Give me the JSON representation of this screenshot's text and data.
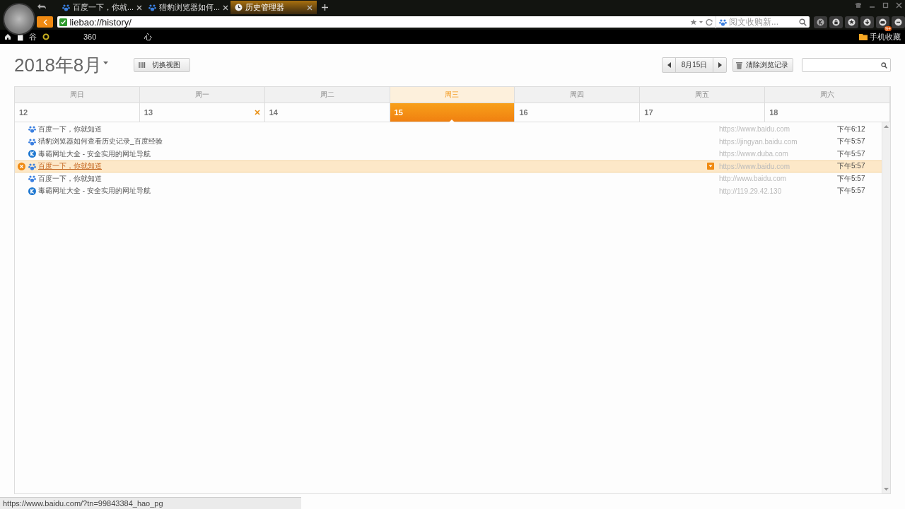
{
  "browser": {
    "tabs": [
      {
        "title": "百度一下，你就...",
        "kind": "paw",
        "selected": false
      },
      {
        "title": "猎豹浏览器如何...",
        "kind": "paw",
        "selected": false
      },
      {
        "title": "历史管理器",
        "kind": "clock",
        "selected": true
      }
    ],
    "address": "liebao://history/",
    "search_placeholder": "阅文收购新...",
    "bookmarks": [
      "谷",
      "360",
      "心"
    ],
    "mobile_bookmarks": "手机收藏",
    "badge": "9+"
  },
  "page": {
    "month": "2018年8月",
    "switch_view": "切换视图",
    "date": "8月15日",
    "clear": "清除浏览记录",
    "days": [
      {
        "weekday": "周日",
        "date": "12",
        "selected": false,
        "deletable": false
      },
      {
        "weekday": "周一",
        "date": "13",
        "selected": false,
        "deletable": true
      },
      {
        "weekday": "周二",
        "date": "14",
        "selected": false,
        "deletable": false
      },
      {
        "weekday": "周三",
        "date": "15",
        "selected": true,
        "deletable": false
      },
      {
        "weekday": "周四",
        "date": "16",
        "selected": false,
        "deletable": false
      },
      {
        "weekday": "周五",
        "date": "17",
        "selected": false,
        "deletable": false
      },
      {
        "weekday": "周六",
        "date": "18",
        "selected": false,
        "deletable": false
      }
    ],
    "entries": [
      {
        "title": "百度一下，你就知道",
        "url": "https://www.baidu.com",
        "time": "下午6:12",
        "kind": "paw",
        "selected": false
      },
      {
        "title": "猎豹浏览器如何查看历史记录_百度经验",
        "url": "https://jingyan.baidu.com",
        "time": "下午5:57",
        "kind": "paw",
        "selected": false
      },
      {
        "title": "毒霸网址大全 - 安全实用的网址导航",
        "url": "https://www.duba.com",
        "time": "下午5:57",
        "kind": "k",
        "selected": false
      },
      {
        "title": "百度一下，你就知道",
        "url": "https://www.baidu.com",
        "time": "下午5:57",
        "kind": "paw",
        "selected": true
      },
      {
        "title": "百度一下，你就知道",
        "url": "http://www.baidu.com",
        "time": "下午5:57",
        "kind": "paw",
        "selected": false
      },
      {
        "title": "毒霸网址大全 - 安全实用的网址导航",
        "url": "http://119.29.42.130",
        "time": "下午5:57",
        "kind": "k",
        "selected": false
      }
    ]
  },
  "status_bar": "https://www.baidu.com/?tn=99843384_hao_pg"
}
